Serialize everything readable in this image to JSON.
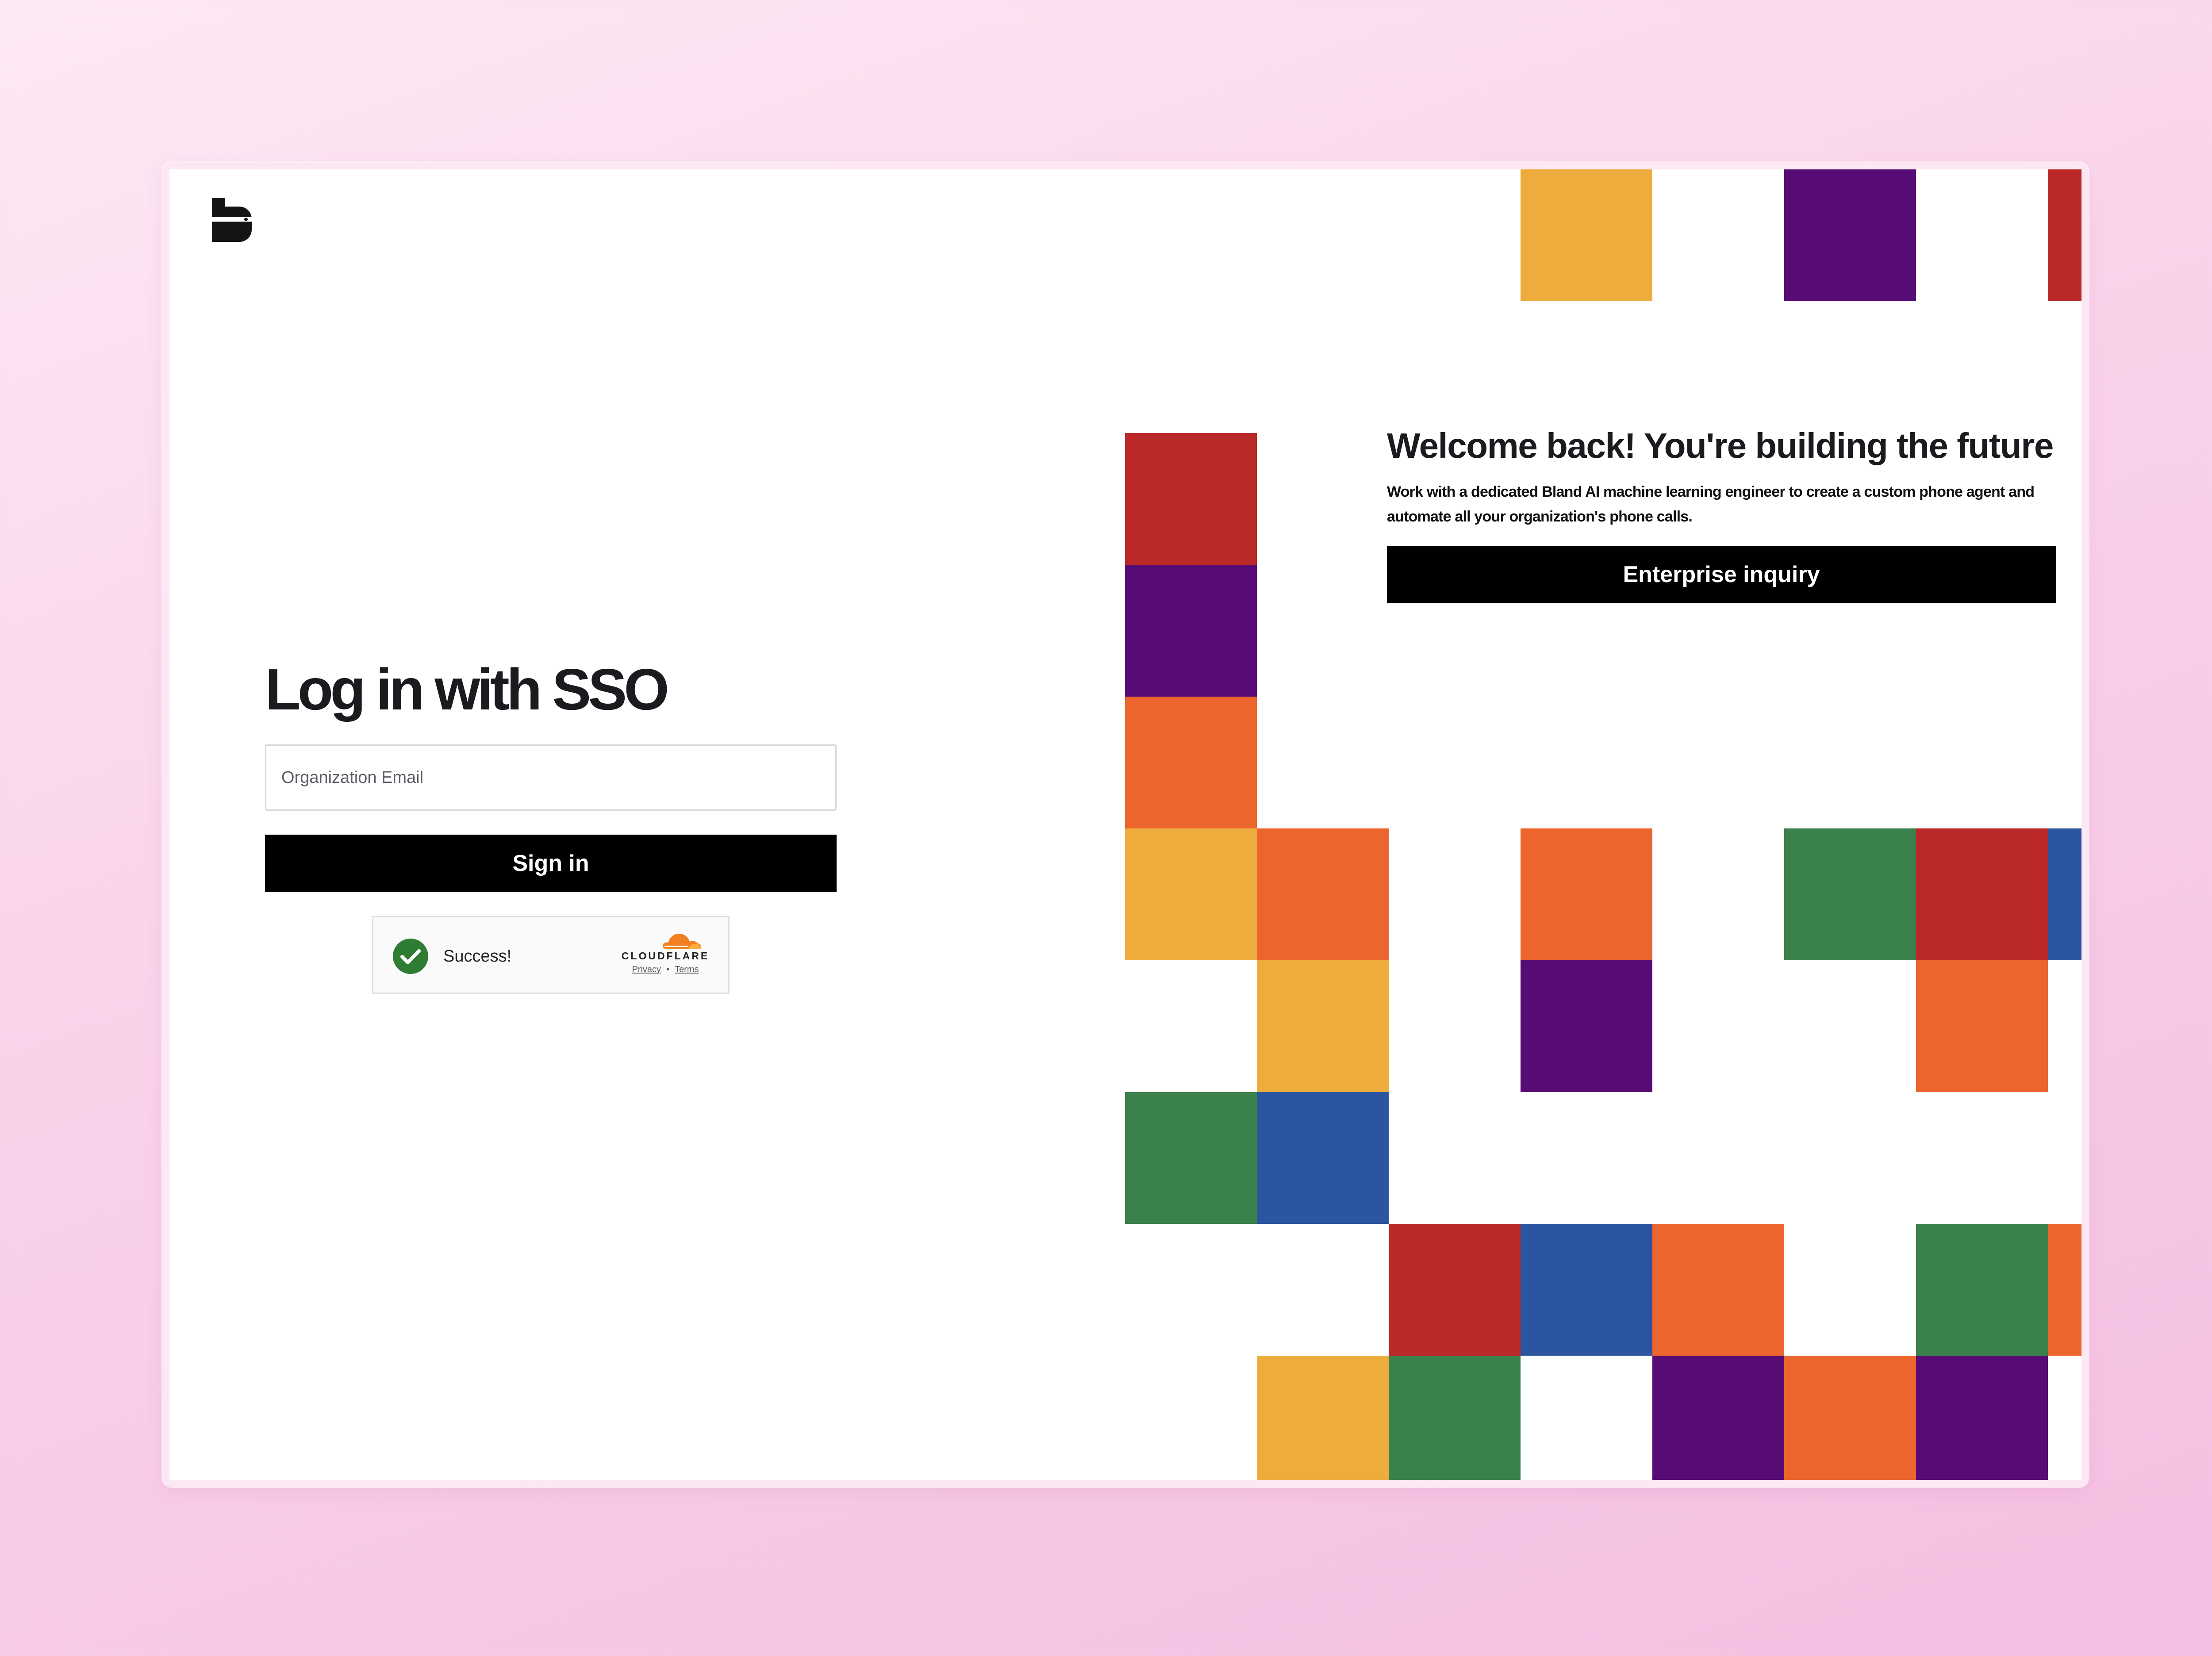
{
  "login": {
    "title": "Log in with SSO",
    "email_placeholder": "Organization Email",
    "email_value": "",
    "sign_in_label": "Sign in"
  },
  "captcha": {
    "status": "Success!",
    "brand": "CLOUDFLARE",
    "privacy": "Privacy",
    "separator": "•",
    "terms": "Terms"
  },
  "promo": {
    "title": "Welcome back! You're building the future",
    "text": "Work with a dedicated Bland AI machine learning engineer to create a custom phone agent and automate all your organization's phone calls.",
    "button_label": "Enterprise inquiry"
  },
  "colors": {
    "yellow": "#EEAC3C",
    "purple": "#560C74",
    "red": "#BA2828",
    "orange": "#EB652C",
    "green": "#3A814C",
    "blue": "#2C55A0",
    "button": "#000000",
    "success_green": "#2E7D32"
  },
  "tiles": [
    {
      "col": 3,
      "row": 0,
      "color": "yellow"
    },
    {
      "col": 5,
      "row": 0,
      "color": "purple"
    },
    {
      "col": 7,
      "row": 0,
      "color": "red"
    },
    {
      "col": 0,
      "row": 2,
      "color": "red"
    },
    {
      "col": 0,
      "row": 3,
      "color": "purple"
    },
    {
      "col": 0,
      "row": 4,
      "color": "orange"
    },
    {
      "col": 0,
      "row": 5,
      "color": "yellow"
    },
    {
      "col": 1,
      "row": 5,
      "color": "orange"
    },
    {
      "col": 3,
      "row": 5,
      "color": "orange"
    },
    {
      "col": 5,
      "row": 5,
      "color": "green"
    },
    {
      "col": 6,
      "row": 5,
      "color": "red"
    },
    {
      "col": 7,
      "row": 5,
      "color": "blue"
    },
    {
      "col": 1,
      "row": 6,
      "color": "yellow"
    },
    {
      "col": 3,
      "row": 6,
      "color": "purple"
    },
    {
      "col": 6,
      "row": 6,
      "color": "orange"
    },
    {
      "col": 0,
      "row": 7,
      "color": "green"
    },
    {
      "col": 1,
      "row": 7,
      "color": "blue"
    },
    {
      "col": 2,
      "row": 8,
      "color": "red"
    },
    {
      "col": 3,
      "row": 8,
      "color": "blue"
    },
    {
      "col": 4,
      "row": 8,
      "color": "orange"
    },
    {
      "col": 6,
      "row": 8,
      "color": "green"
    },
    {
      "col": 7,
      "row": 8,
      "color": "orange"
    },
    {
      "col": 1,
      "row": 9,
      "color": "yellow"
    },
    {
      "col": 2,
      "row": 9,
      "color": "green"
    },
    {
      "col": 4,
      "row": 9,
      "color": "purple"
    },
    {
      "col": 5,
      "row": 9,
      "color": "orange"
    },
    {
      "col": 6,
      "row": 9,
      "color": "purple"
    }
  ]
}
